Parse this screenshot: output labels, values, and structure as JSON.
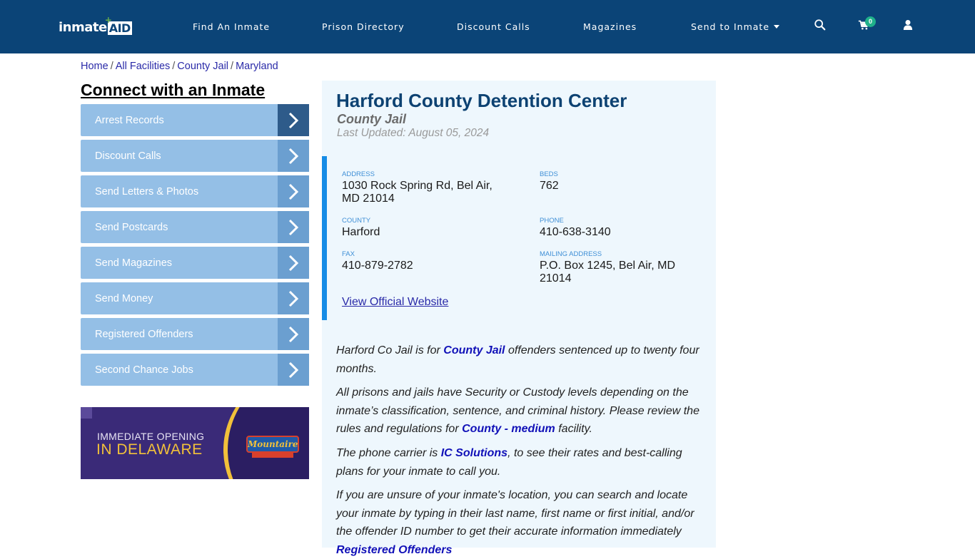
{
  "header": {
    "logo": {
      "part1": "inmate",
      "part2": "AID",
      "plus": "+"
    },
    "nav": [
      {
        "label": "Find An Inmate"
      },
      {
        "label": "Prison Directory"
      },
      {
        "label": "Discount Calls"
      },
      {
        "label": "Magazines"
      },
      {
        "label": "Send to Inmate",
        "has_dropdown": true
      }
    ],
    "icons": {
      "search": "search-icon",
      "cart": "cart-icon",
      "user": "user-icon"
    },
    "cart_count": "0"
  },
  "breadcrumb": [
    {
      "label": "Home"
    },
    {
      "label": "All Facilities"
    },
    {
      "label": "County Jail"
    },
    {
      "label": "Maryland"
    }
  ],
  "breadcrumb_separator": "/",
  "sidebar": {
    "title": "Connect with an Inmate",
    "items": [
      {
        "label": "Arrest Records"
      },
      {
        "label": "Discount Calls"
      },
      {
        "label": "Send Letters & Photos"
      },
      {
        "label": "Send Postcards"
      },
      {
        "label": "Send Magazines"
      },
      {
        "label": "Send Money"
      },
      {
        "label": "Registered Offenders"
      },
      {
        "label": "Second Chance Jobs"
      }
    ],
    "ad": {
      "line1": "IMMEDIATE OPENING",
      "line2": "IN DELAWARE",
      "brand": "Mountaire"
    }
  },
  "facility": {
    "name": "Harford County Detention Center",
    "type": "County Jail",
    "last_updated": "Last Updated: August 05, 2024",
    "fields": {
      "address": {
        "label": "ADDRESS",
        "value": "1030 Rock Spring Rd, Bel Air, MD 21014"
      },
      "beds": {
        "label": "BEDS",
        "value": "762"
      },
      "county": {
        "label": "COUNTY",
        "value": "Harford"
      },
      "phone": {
        "label": "PHONE",
        "value": "410-638-3140"
      },
      "fax": {
        "label": "FAX",
        "value": "410-879-2782"
      },
      "mailing": {
        "label": "MAILING ADDRESS",
        "value": "P.O. Box 1245, Bel Air, MD 21014"
      }
    },
    "website_link": "View Official Website"
  },
  "description": {
    "p1": {
      "before": "Harford Co Jail is for ",
      "link": "County Jail",
      "after": " offenders sentenced up to twenty four months."
    },
    "p2": {
      "before": "All prisons and jails have Security or Custody levels depending on the inmate’s classification, sentence, and criminal history. Please review the rules and regulations for ",
      "link": "County - medium",
      "after": " facility."
    },
    "p3": {
      "before": "The phone carrier is ",
      "link": "IC Solutions",
      "after": ", to see their rates and best-calling plans for your inmate to call you."
    },
    "p4": {
      "before": "If you are unsure of your inmate's location, you can search and locate your inmate by typing in their last name, first name or first initial, and/or the offender ID number to get their accurate information immediately ",
      "link": "Registered Offenders"
    }
  }
}
